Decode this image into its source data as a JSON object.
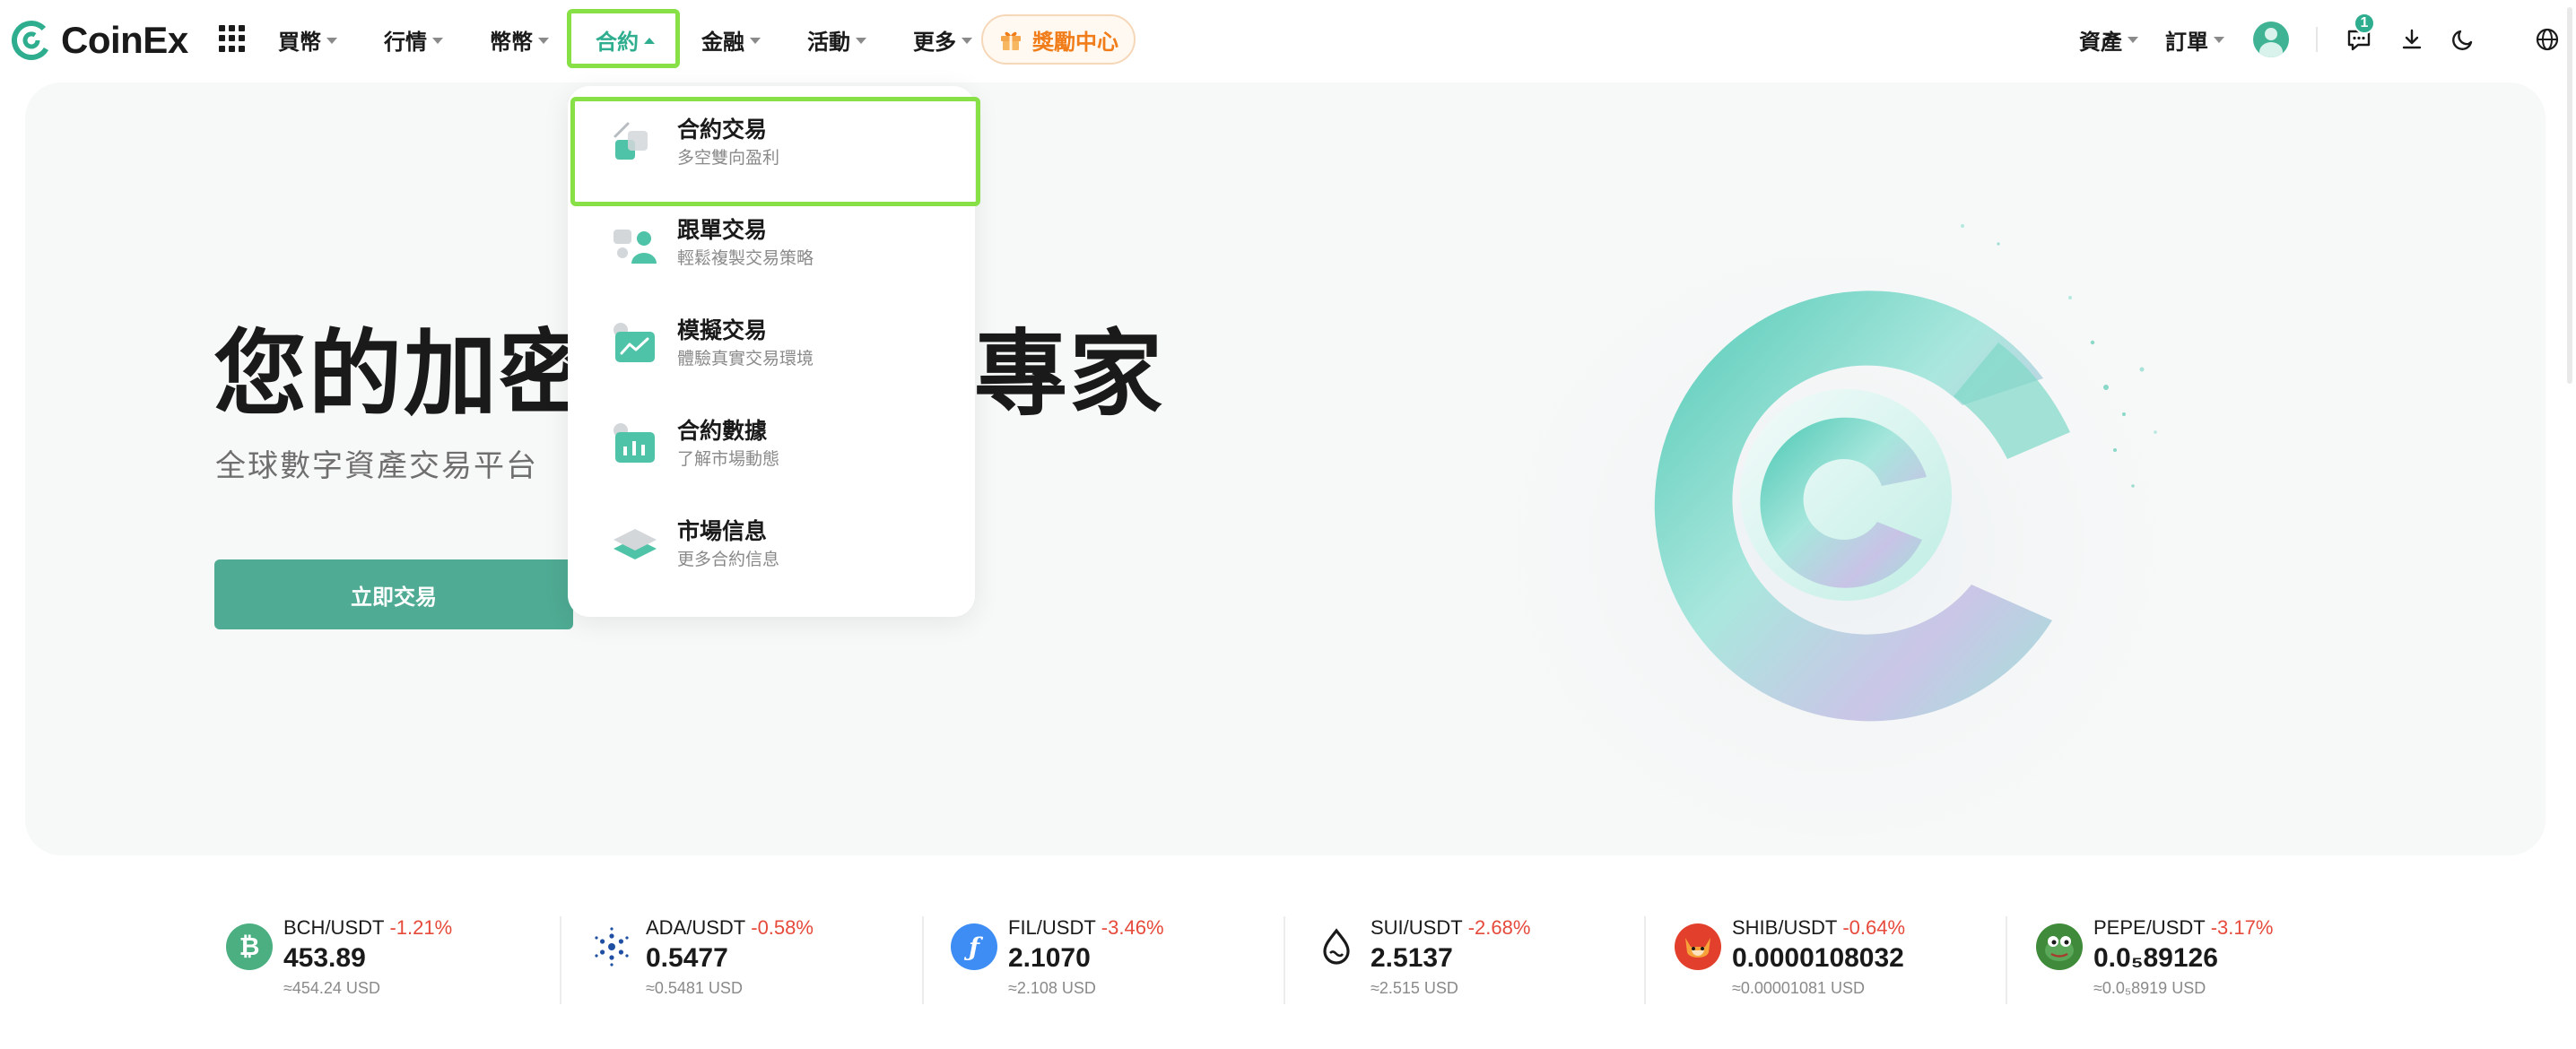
{
  "brand": {
    "name": "CoinEx",
    "accent": "#2fae8f"
  },
  "nav": {
    "items": [
      {
        "label": "買幣"
      },
      {
        "label": "行情"
      },
      {
        "label": "幣幣"
      },
      {
        "label": "合約"
      },
      {
        "label": "金融"
      },
      {
        "label": "活動"
      },
      {
        "label": "更多"
      }
    ],
    "active": "合約",
    "reward_label": "獎勵中心"
  },
  "right_nav": {
    "assets_label": "資產",
    "orders_label": "訂單",
    "notification_count": "1"
  },
  "hero": {
    "title": "您的加密貨幣交易專家",
    "subtitle": "全球數字資產交易平台",
    "cta_label": "立即交易"
  },
  "dropdown": {
    "items": [
      {
        "title": "合約交易",
        "desc": "多空雙向盈利",
        "icon": "futures-trade-icon"
      },
      {
        "title": "跟單交易",
        "desc": "輕鬆複製交易策略",
        "icon": "copy-trade-icon"
      },
      {
        "title": "模擬交易",
        "desc": "體驗真實交易環境",
        "icon": "demo-trade-icon"
      },
      {
        "title": "合約數據",
        "desc": "了解市場動態",
        "icon": "futures-data-icon"
      },
      {
        "title": "市場信息",
        "desc": "更多合約信息",
        "icon": "market-info-icon"
      }
    ]
  },
  "ticker": [
    {
      "pair": "BCH/USDT",
      "change": "-1.21%",
      "price": "453.89",
      "usd": "≈454.24 USD",
      "icon": "bch-icon",
      "color": "#4caf82"
    },
    {
      "pair": "ADA/USDT",
      "change": "-0.58%",
      "price": "0.5477",
      "usd": "≈0.5481 USD",
      "icon": "ada-icon",
      "color": "#1f4fa3"
    },
    {
      "pair": "FIL/USDT",
      "change": "-3.46%",
      "price": "2.1070",
      "usd": "≈2.108 USD",
      "icon": "fil-icon",
      "color": "#3d8df5"
    },
    {
      "pair": "SUI/USDT",
      "change": "-2.68%",
      "price": "2.5137",
      "usd": "≈2.515 USD",
      "icon": "sui-icon",
      "color": "#1a1a1a"
    },
    {
      "pair": "SHIB/USDT",
      "change": "-0.64%",
      "price": "0.0000108032",
      "usd": "≈0.00001081 USD",
      "icon": "shib-icon",
      "color": "#e2402c"
    },
    {
      "pair": "PEPE/USDT",
      "change": "-3.17%",
      "price": "0.0₅89126",
      "usd": "≈0.0₅8919 USD",
      "icon": "pepe-icon",
      "color": "#3f8b3b"
    }
  ]
}
